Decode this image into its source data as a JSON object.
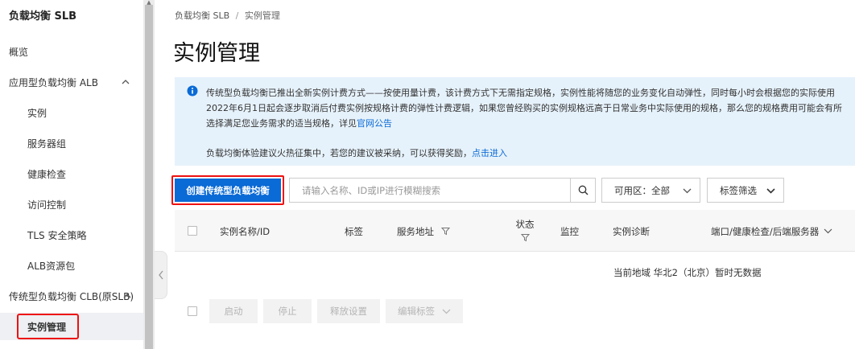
{
  "sidebar": {
    "title": "负载均衡 SLB",
    "items": [
      {
        "label": "概览"
      },
      {
        "label": "应用型负载均衡 ALB"
      },
      {
        "label": "实例"
      },
      {
        "label": "服务器组"
      },
      {
        "label": "健康检查"
      },
      {
        "label": "访问控制"
      },
      {
        "label": "TLS 安全策略"
      },
      {
        "label": "ALB资源包"
      },
      {
        "label": "传统型负载均衡 CLB(原SLB)"
      },
      {
        "label": "实例管理"
      }
    ]
  },
  "breadcrumb": {
    "root": "负载均衡 SLB",
    "sep": "/",
    "current": "实例管理"
  },
  "page_title": "实例管理",
  "notice": {
    "line1": "传统型负载均衡已推出全新实例计费方式——按使用量计费，该计费方式下无需指定规格，实例性能将随您的业务变化自动弹性，同时每小时会根据您的实际使用",
    "line2": "2022年6月1日起会逐步取消后付费实例按规格计费的弹性计费逻辑，如果您曾经购买的实例规格远高于日常业务中实际使用的规格，那么您的规格费用可能会有所",
    "line3_prefix": "选择满足您业务需求的适当规格，详见",
    "line3_link": "官网公告",
    "line4_prefix": "负载均衡体验建议火热征集中，若您的建议被采纳，可以获得奖励，",
    "line4_link": "点击进入"
  },
  "toolbar": {
    "create_label": "创建传统型负载均衡",
    "search_placeholder": "请输入名称、ID或IP进行模糊搜索",
    "zone_label": "可用区：全部",
    "tag_filter_label": "标签筛选"
  },
  "table": {
    "headers": {
      "name": "实例名称/ID",
      "tags": "标签",
      "address": "服务地址",
      "status": "状态",
      "monitor": "监控",
      "diagnosis": "实例诊断",
      "ports": "端口/健康检查/后端服务器"
    },
    "empty_message": "当前地域 华北2（北京）暂时无数据"
  },
  "bulk_actions": {
    "start": "启动",
    "stop": "停止",
    "release": "释放设置",
    "edit_tags": "编辑标签"
  },
  "colors": {
    "accent": "#0a6ad6",
    "highlight": "#e11111",
    "notice_bg": "#e6f2fb"
  }
}
